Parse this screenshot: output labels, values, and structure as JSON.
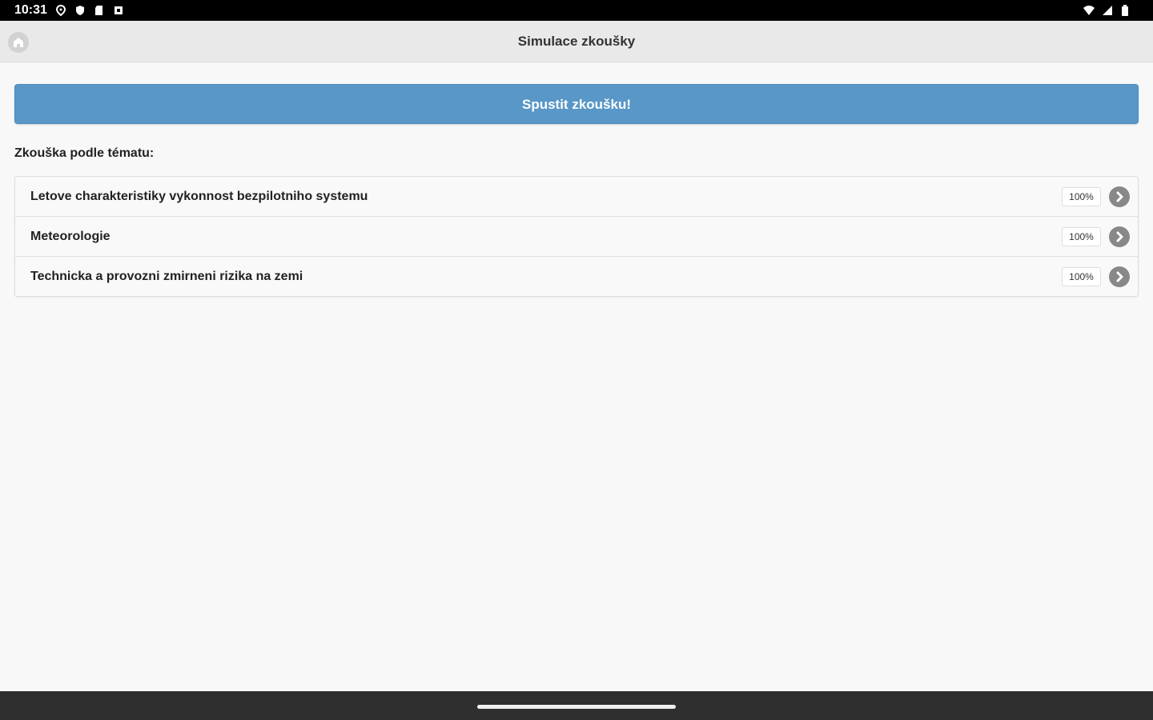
{
  "status_bar": {
    "time": "10:31",
    "left_icons": [
      "location-icon",
      "shield-icon",
      "sd-card-icon",
      "square-notification-icon"
    ],
    "right_icons": [
      "wifi-icon",
      "signal-icon",
      "battery-icon"
    ]
  },
  "header": {
    "title": "Simulace zkoušky",
    "home_icon": "home-icon"
  },
  "main": {
    "start_button_label": "Spustit zkoušku!",
    "section_label": "Zkouška podle tématu:",
    "topics": [
      {
        "label": "Letove charakteristiky vykonnost bezpilotniho systemu",
        "percent": "100%"
      },
      {
        "label": "Meteorologie",
        "percent": "100%"
      },
      {
        "label": "Technicka a provozni zmirneni rizika na zemi",
        "percent": "100%"
      }
    ]
  },
  "colors": {
    "accent": "#5897c7",
    "header_bg": "#e9e9e9",
    "page_bg": "#f8f8f8",
    "status_bar_bg": "#000000",
    "nav_bar_bg": "#2f2f2f",
    "arrow_icon_bg": "#888888"
  }
}
